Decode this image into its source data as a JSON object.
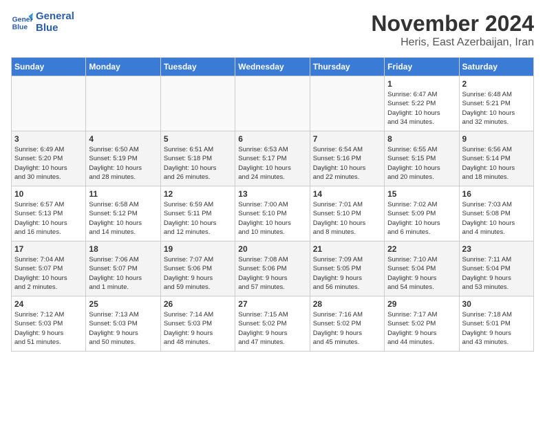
{
  "logo": {
    "line1": "General",
    "line2": "Blue"
  },
  "title": "November 2024",
  "subtitle": "Heris, East Azerbaijan, Iran",
  "weekdays": [
    "Sunday",
    "Monday",
    "Tuesday",
    "Wednesday",
    "Thursday",
    "Friday",
    "Saturday"
  ],
  "weeks": [
    [
      {
        "day": "",
        "info": ""
      },
      {
        "day": "",
        "info": ""
      },
      {
        "day": "",
        "info": ""
      },
      {
        "day": "",
        "info": ""
      },
      {
        "day": "",
        "info": ""
      },
      {
        "day": "1",
        "info": "Sunrise: 6:47 AM\nSunset: 5:22 PM\nDaylight: 10 hours\nand 34 minutes."
      },
      {
        "day": "2",
        "info": "Sunrise: 6:48 AM\nSunset: 5:21 PM\nDaylight: 10 hours\nand 32 minutes."
      }
    ],
    [
      {
        "day": "3",
        "info": "Sunrise: 6:49 AM\nSunset: 5:20 PM\nDaylight: 10 hours\nand 30 minutes."
      },
      {
        "day": "4",
        "info": "Sunrise: 6:50 AM\nSunset: 5:19 PM\nDaylight: 10 hours\nand 28 minutes."
      },
      {
        "day": "5",
        "info": "Sunrise: 6:51 AM\nSunset: 5:18 PM\nDaylight: 10 hours\nand 26 minutes."
      },
      {
        "day": "6",
        "info": "Sunrise: 6:53 AM\nSunset: 5:17 PM\nDaylight: 10 hours\nand 24 minutes."
      },
      {
        "day": "7",
        "info": "Sunrise: 6:54 AM\nSunset: 5:16 PM\nDaylight: 10 hours\nand 22 minutes."
      },
      {
        "day": "8",
        "info": "Sunrise: 6:55 AM\nSunset: 5:15 PM\nDaylight: 10 hours\nand 20 minutes."
      },
      {
        "day": "9",
        "info": "Sunrise: 6:56 AM\nSunset: 5:14 PM\nDaylight: 10 hours\nand 18 minutes."
      }
    ],
    [
      {
        "day": "10",
        "info": "Sunrise: 6:57 AM\nSunset: 5:13 PM\nDaylight: 10 hours\nand 16 minutes."
      },
      {
        "day": "11",
        "info": "Sunrise: 6:58 AM\nSunset: 5:12 PM\nDaylight: 10 hours\nand 14 minutes."
      },
      {
        "day": "12",
        "info": "Sunrise: 6:59 AM\nSunset: 5:11 PM\nDaylight: 10 hours\nand 12 minutes."
      },
      {
        "day": "13",
        "info": "Sunrise: 7:00 AM\nSunset: 5:10 PM\nDaylight: 10 hours\nand 10 minutes."
      },
      {
        "day": "14",
        "info": "Sunrise: 7:01 AM\nSunset: 5:10 PM\nDaylight: 10 hours\nand 8 minutes."
      },
      {
        "day": "15",
        "info": "Sunrise: 7:02 AM\nSunset: 5:09 PM\nDaylight: 10 hours\nand 6 minutes."
      },
      {
        "day": "16",
        "info": "Sunrise: 7:03 AM\nSunset: 5:08 PM\nDaylight: 10 hours\nand 4 minutes."
      }
    ],
    [
      {
        "day": "17",
        "info": "Sunrise: 7:04 AM\nSunset: 5:07 PM\nDaylight: 10 hours\nand 2 minutes."
      },
      {
        "day": "18",
        "info": "Sunrise: 7:06 AM\nSunset: 5:07 PM\nDaylight: 10 hours\nand 1 minute."
      },
      {
        "day": "19",
        "info": "Sunrise: 7:07 AM\nSunset: 5:06 PM\nDaylight: 9 hours\nand 59 minutes."
      },
      {
        "day": "20",
        "info": "Sunrise: 7:08 AM\nSunset: 5:06 PM\nDaylight: 9 hours\nand 57 minutes."
      },
      {
        "day": "21",
        "info": "Sunrise: 7:09 AM\nSunset: 5:05 PM\nDaylight: 9 hours\nand 56 minutes."
      },
      {
        "day": "22",
        "info": "Sunrise: 7:10 AM\nSunset: 5:04 PM\nDaylight: 9 hours\nand 54 minutes."
      },
      {
        "day": "23",
        "info": "Sunrise: 7:11 AM\nSunset: 5:04 PM\nDaylight: 9 hours\nand 53 minutes."
      }
    ],
    [
      {
        "day": "24",
        "info": "Sunrise: 7:12 AM\nSunset: 5:03 PM\nDaylight: 9 hours\nand 51 minutes."
      },
      {
        "day": "25",
        "info": "Sunrise: 7:13 AM\nSunset: 5:03 PM\nDaylight: 9 hours\nand 50 minutes."
      },
      {
        "day": "26",
        "info": "Sunrise: 7:14 AM\nSunset: 5:03 PM\nDaylight: 9 hours\nand 48 minutes."
      },
      {
        "day": "27",
        "info": "Sunrise: 7:15 AM\nSunset: 5:02 PM\nDaylight: 9 hours\nand 47 minutes."
      },
      {
        "day": "28",
        "info": "Sunrise: 7:16 AM\nSunset: 5:02 PM\nDaylight: 9 hours\nand 45 minutes."
      },
      {
        "day": "29",
        "info": "Sunrise: 7:17 AM\nSunset: 5:02 PM\nDaylight: 9 hours\nand 44 minutes."
      },
      {
        "day": "30",
        "info": "Sunrise: 7:18 AM\nSunset: 5:01 PM\nDaylight: 9 hours\nand 43 minutes."
      }
    ]
  ]
}
